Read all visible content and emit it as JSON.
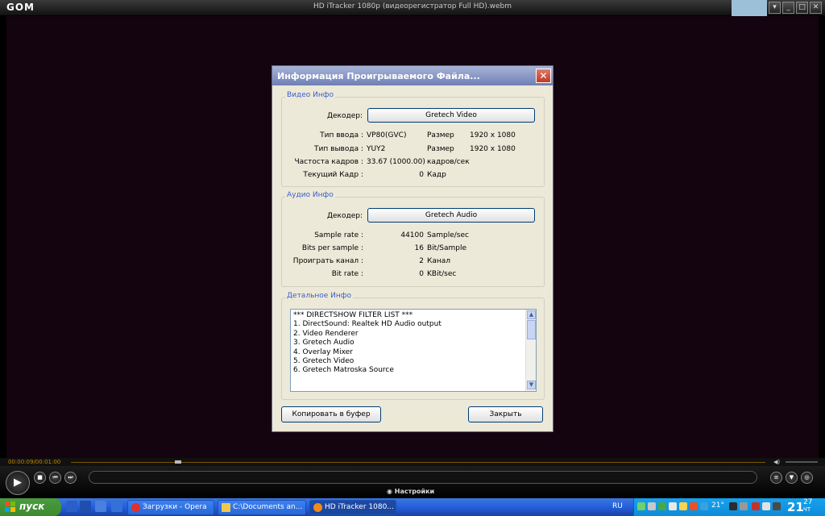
{
  "player": {
    "logo": "GOM",
    "window_title": "HD iTracker 1080p (видеорегистратор Full HD).webm",
    "time": "00:00:09/00:01:00",
    "settings_label": "Настройки"
  },
  "dialog": {
    "title": "Информация Проигрываемого Файла...",
    "video": {
      "group_label": "Видео Инфо",
      "decoder_label": "Декодер:",
      "decoder_value": "Gretech Video",
      "input_type_label": "Тип ввода :",
      "input_type_value": "VP80(GVC)",
      "input_size_label": "Размер",
      "input_size_value": "1920 x 1080",
      "output_type_label": "Тип вывода :",
      "output_type_value": "YUY2",
      "output_size_label": "Размер",
      "output_size_value": "1920 x 1080",
      "framerate_label": "Частоста кадров :",
      "framerate_value": "33.67 (1000.00)",
      "framerate_unit": "кадров/сек",
      "current_frame_label": "Текущий Кадр :",
      "current_frame_value": "0",
      "current_frame_unit": "Кадр"
    },
    "audio": {
      "group_label": "Аудио Инфо",
      "decoder_label": "Декодер:",
      "decoder_value": "Gretech Audio",
      "sample_rate_label": "Sample rate :",
      "sample_rate_value": "44100",
      "sample_rate_unit": "Sample/sec",
      "bits_label": "Bits per sample :",
      "bits_value": "16",
      "bits_unit": "Bit/Sample",
      "channel_label": "Проиграть канал :",
      "channel_value": "2",
      "channel_unit": "Канал",
      "bitrate_label": "Bit rate :",
      "bitrate_value": "0",
      "bitrate_unit": "KBit/sec"
    },
    "detail": {
      "group_label": "Детальное Инфо",
      "lines": [
        "*** DIRECTSHOW FILTER LIST ***",
        "1. DirectSound: Realtek HD Audio output",
        "2. Video Renderer",
        "3. Gretech Audio",
        "4. Overlay Mixer",
        "5. Gretech Video",
        "6. Gretech Matroska Source"
      ]
    },
    "copy_button": "Копировать в буфер",
    "close_button": "Закрыть"
  },
  "taskbar": {
    "start_label": "пуск",
    "tasks": [
      {
        "label": "Загрузки - Opera"
      },
      {
        "label": "C:\\Documents an..."
      },
      {
        "label": "HD iTracker 1080..."
      }
    ],
    "lang": "RU",
    "temperature": "21°",
    "clock_hour": "21",
    "clock_minute": "27",
    "clock_day": "Ч",
    "clock_suffix": "Т"
  }
}
